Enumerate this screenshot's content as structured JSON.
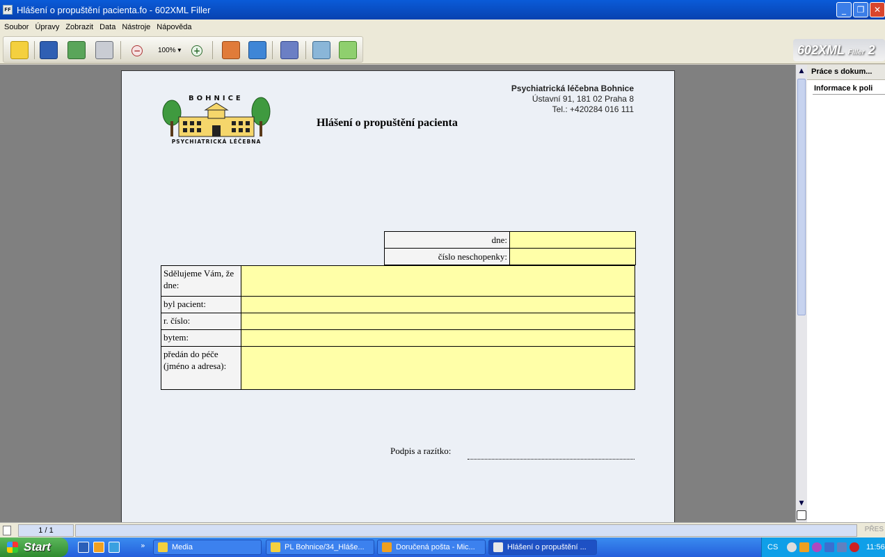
{
  "window": {
    "title": "Hlášení o propuštění pacienta.fo - 602XML Filler",
    "app_icon": "FF"
  },
  "menu": [
    "Soubor",
    "Úpravy",
    "Zobrazit",
    "Data",
    "Nástroje",
    "Nápověda"
  ],
  "toolbar": {
    "zoom": "100%",
    "zoom_caret": "▾",
    "brand": "602XML",
    "brand_sub": "Filler",
    "brand_num": "2",
    "brand_tail": "602"
  },
  "document": {
    "org_name": "Psychiatrická léčebna Bohnice",
    "org_address": "Ústavní 91, 181 02 Praha 8",
    "org_phone": "Tel.: +420284 016 111",
    "logo_top": "BOHNICE",
    "logo_bottom": "PSYCHIATRICKÁ LÉČEBNA",
    "title": "Hlášení o propuštění pacienta",
    "top_fields": [
      {
        "label": "dne:",
        "value": ""
      },
      {
        "label": "číslo neschopenky:",
        "value": ""
      }
    ],
    "main_fields": [
      {
        "label": "Sdělujeme Vám, že dne:",
        "value": ""
      },
      {
        "label": "byl pacient:",
        "value": ""
      },
      {
        "label": "r. číslo:",
        "value": ""
      },
      {
        "label": "bytem:",
        "value": ""
      },
      {
        "label": "předán do péče (jméno a adresa):",
        "value": ""
      }
    ],
    "signature_label": "Podpis a razítko:"
  },
  "side_panel": {
    "header": "Práce s dokum...",
    "sub": "Informace k poli"
  },
  "status": {
    "page": "1 / 1",
    "mode": "PŘES"
  },
  "taskbar": {
    "start": "Start",
    "buttons": [
      "Media",
      "PL Bohnice/34_Hláše...",
      "Doručená pošta - Mic...",
      "Hlášení o propuštění ..."
    ],
    "lang": "CS",
    "clock": "11:56",
    "more": "»"
  }
}
